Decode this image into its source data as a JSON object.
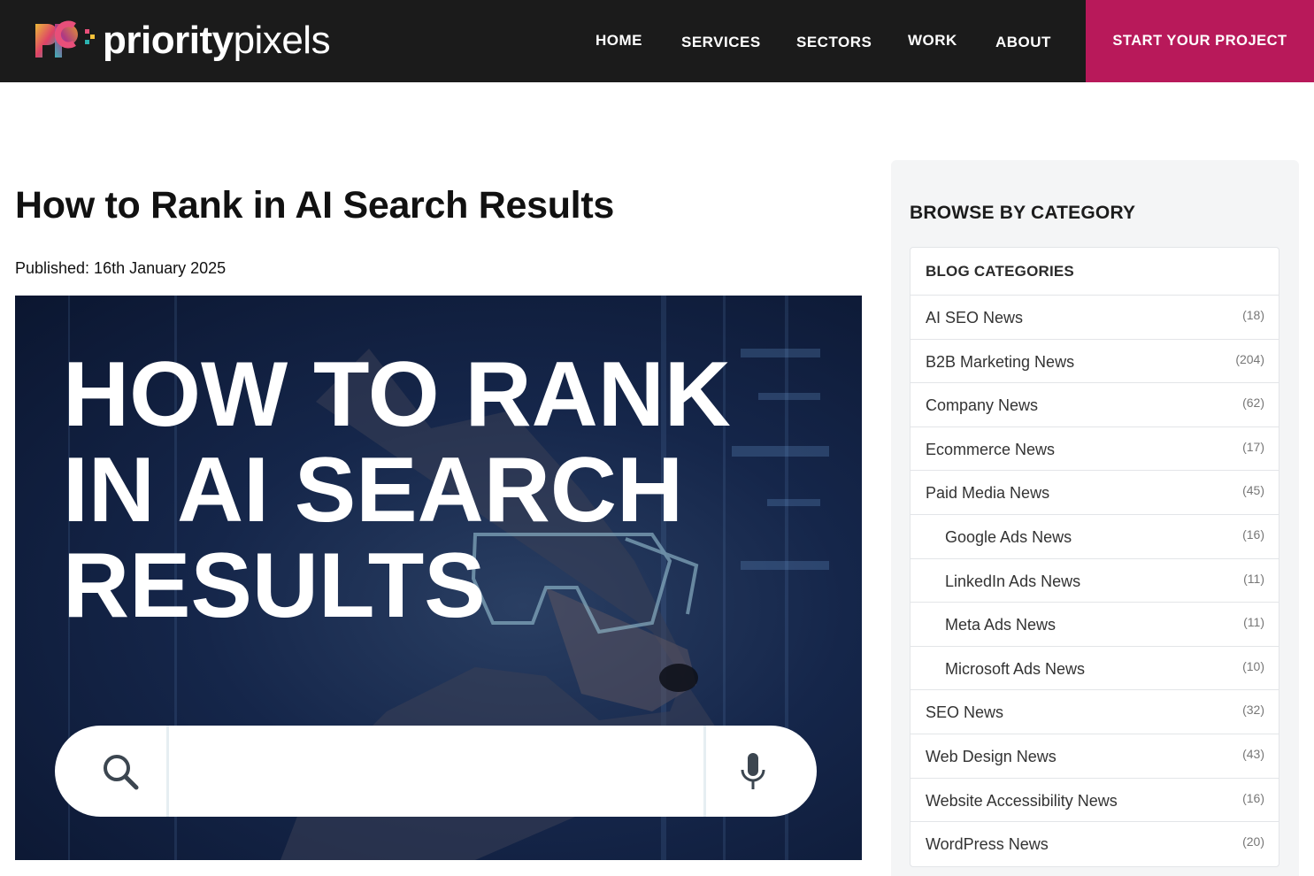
{
  "header": {
    "logo": {
      "bold": "priority",
      "light": "pixels"
    },
    "nav": [
      {
        "label": "HOME"
      },
      {
        "label": "SERVICES"
      },
      {
        "label": "SECTORS"
      },
      {
        "label": "WORK"
      },
      {
        "label": "ABOUT"
      }
    ],
    "cta_label": "START YOUR PROJECT"
  },
  "article": {
    "title": "How to Rank in AI Search Results",
    "published": "Published: 16th January 2025",
    "hero": {
      "lines": [
        "HOW TO RANK",
        "IN AI SEARCH",
        "RESULTS"
      ],
      "icons": {
        "search": "search-icon",
        "mic": "microphone-icon"
      }
    }
  },
  "sidebar": {
    "heading": "BROWSE BY CATEGORY",
    "box_heading": "BLOG CATEGORIES",
    "categories": [
      {
        "label": "AI SEO News",
        "count": "(18)"
      },
      {
        "label": "B2B Marketing News",
        "count": "(204)"
      },
      {
        "label": "Company News",
        "count": "(62)"
      },
      {
        "label": "Ecommerce News",
        "count": "(17)"
      },
      {
        "label": "Paid Media News",
        "count": "(45)"
      },
      {
        "label": "Google Ads News",
        "count": "(16)"
      },
      {
        "label": "LinkedIn Ads News",
        "count": "(11)"
      },
      {
        "label": "Meta Ads News",
        "count": "(11)"
      },
      {
        "label": "Microsoft Ads News",
        "count": "(10)"
      },
      {
        "label": "SEO News",
        "count": "(32)"
      },
      {
        "label": "Web Design News",
        "count": "(43)"
      },
      {
        "label": "Website Accessibility News",
        "count": "(16)"
      },
      {
        "label": "WordPress News",
        "count": "(20)"
      }
    ]
  },
  "colors": {
    "header_bg": "#1b1b1b",
    "cta_bg": "#b8195a",
    "sidebar_bg": "#f4f5f6"
  }
}
